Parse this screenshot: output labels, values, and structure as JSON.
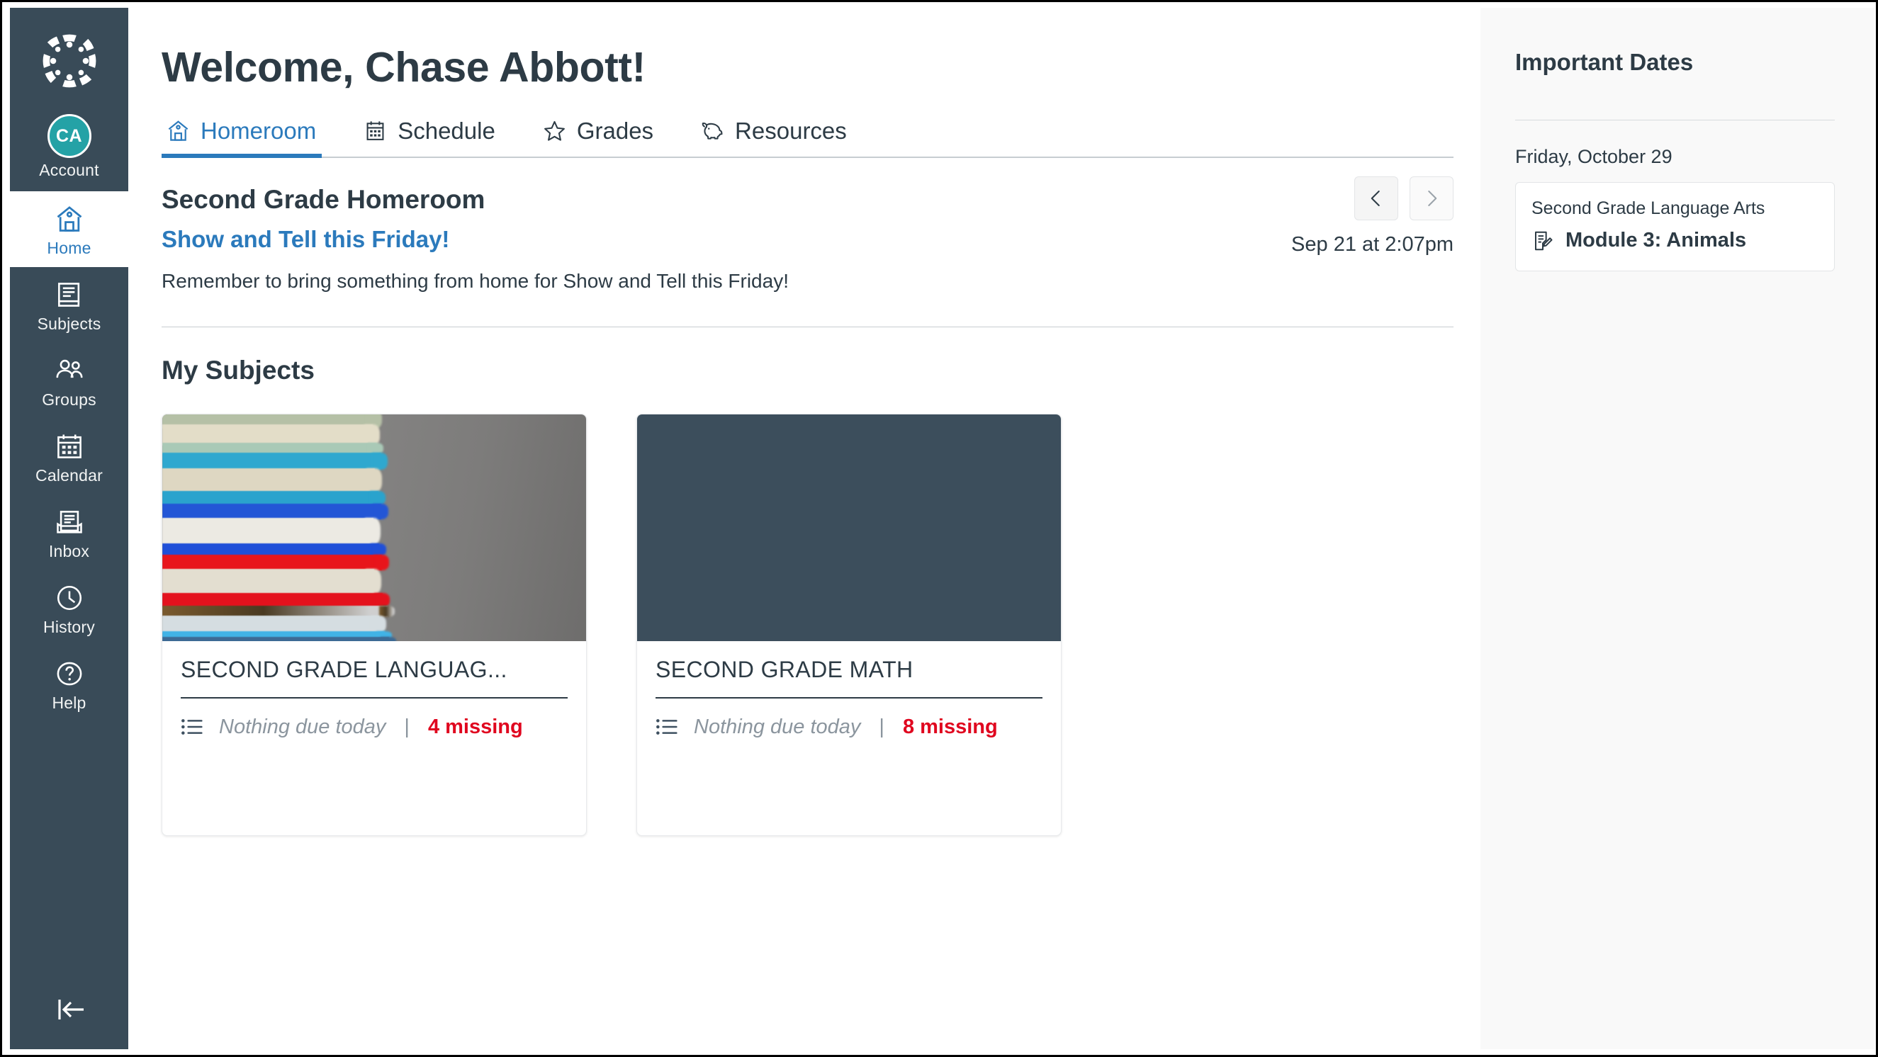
{
  "global_nav": {
    "logo_alt": "canvas-logo",
    "account": {
      "initials": "CA",
      "label": "Account"
    },
    "items": [
      {
        "label": "Home",
        "icon": "home-icon",
        "active": true
      },
      {
        "label": "Subjects",
        "icon": "book-icon",
        "active": false
      },
      {
        "label": "Groups",
        "icon": "groups-icon",
        "active": false
      },
      {
        "label": "Calendar",
        "icon": "calendar-icon",
        "active": false
      },
      {
        "label": "Inbox",
        "icon": "inbox-icon",
        "active": false
      },
      {
        "label": "History",
        "icon": "clock-icon",
        "active": false
      },
      {
        "label": "Help",
        "icon": "question-icon",
        "active": false
      }
    ],
    "collapse_label": "Minimize Global Navigation"
  },
  "header": {
    "title": "Welcome, Chase Abbott!"
  },
  "tabs": [
    {
      "label": "Homeroom",
      "icon": "home-icon",
      "active": true
    },
    {
      "label": "Schedule",
      "icon": "calendar-icon",
      "active": false
    },
    {
      "label": "Grades",
      "icon": "star-icon",
      "active": false
    },
    {
      "label": "Resources",
      "icon": "piggy-bank-icon",
      "active": false
    }
  ],
  "homeroom": {
    "title": "Second Grade Homeroom",
    "announcement_link": "Show and Tell this Friday!",
    "announcement_body": "Remember to bring something from home for Show and Tell this Friday!",
    "date": "Sep 21 at 2:07pm",
    "prev_label": "Previous announcement",
    "next_label": "Next announcement"
  },
  "subjects": {
    "heading": "My Subjects",
    "cards": [
      {
        "name": "SECOND GRADE LANGUAG...",
        "full_name": "SECOND GRADE LANGUAGE ARTS",
        "banner_type": "photo-books",
        "due_text": "Nothing due today",
        "separator": "|",
        "missing": "4 missing"
      },
      {
        "name": "SECOND GRADE MATH",
        "full_name": "SECOND GRADE MATH",
        "banner_type": "solid",
        "banner_color": "#3C4E5C",
        "due_text": "Nothing due today",
        "separator": "|",
        "missing": "8 missing"
      }
    ]
  },
  "important_dates": {
    "heading": "Important Dates",
    "groups": [
      {
        "day": "Friday, October 29",
        "events": [
          {
            "context": "Second Grade Language Arts",
            "title": "Module 3: Animals",
            "icon": "assignment-icon"
          }
        ]
      }
    ]
  },
  "colors": {
    "nav_bg": "#394B58",
    "brand_blue": "#2B7ABC",
    "avatar_teal": "#24A2A6",
    "text_dark": "#2D3B45",
    "missing_red": "#E0061F",
    "muted_grey": "#8B959E",
    "panel_bg": "#F9F9F9"
  }
}
